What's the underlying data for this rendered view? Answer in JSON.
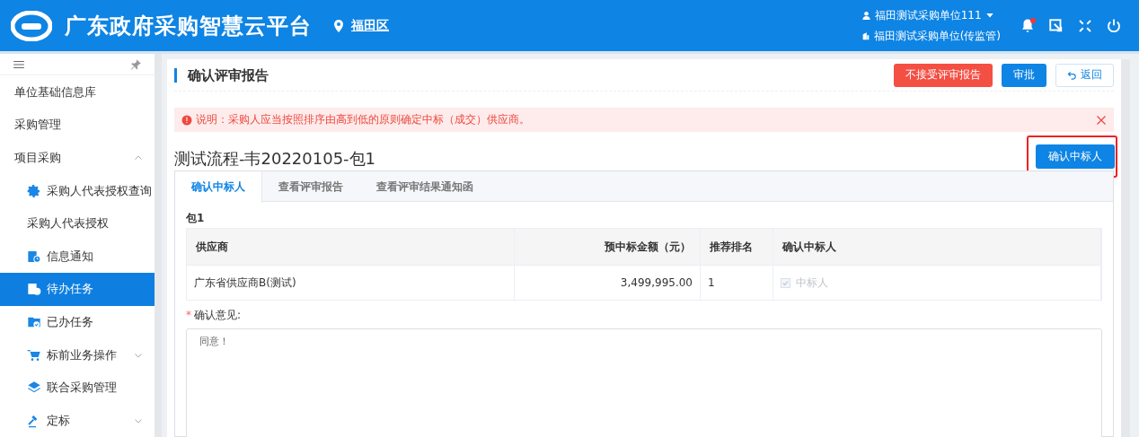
{
  "header": {
    "title": "广东政府采购智慧云平台",
    "region": "福田区",
    "user": "福田测试采购单位111",
    "org": "福田测试采购单位(传监管)",
    "has_notification": true
  },
  "sidebar": {
    "items": [
      {
        "label": "单位基础信息库",
        "selected": false
      },
      {
        "label": "采购管理",
        "selected": false
      },
      {
        "label": "项目采购",
        "selected": false,
        "expanded": true,
        "children": [
          {
            "label": "采购人代表授权查询",
            "kind": "settings",
            "selected": false
          },
          {
            "label": "采购人代表授权",
            "kind": "plain",
            "selected": false
          },
          {
            "label": "信息通知",
            "kind": "notice",
            "selected": false
          },
          {
            "label": "待办任务",
            "kind": "notice",
            "selected": true
          },
          {
            "label": "已办任务",
            "kind": "done",
            "selected": false
          },
          {
            "label": "标前业务操作",
            "kind": "shopping",
            "selected": false,
            "expanded": false
          },
          {
            "label": "联合采购管理",
            "kind": "joint",
            "selected": false
          },
          {
            "label": "定标",
            "kind": "award",
            "selected": false,
            "expanded": false
          }
        ]
      }
    ]
  },
  "page": {
    "title": "确认评审报告",
    "buttons": [
      {
        "label": "不接受评审报告",
        "kind": "danger"
      },
      {
        "label": "审批",
        "kind": "primary"
      },
      {
        "label": "返回",
        "kind": "back"
      }
    ],
    "alert": "说明：采购人应当按照排序由高到低的原则确定中标（成交）供应商。",
    "project": "测试流程-韦20220105-包1",
    "confirm_button": "确认中标人",
    "tabs": [
      {
        "label": "确认中标人",
        "selected": true
      },
      {
        "label": "查看评审报告",
        "selected": false
      },
      {
        "label": "查看评审结果通知函",
        "selected": false
      }
    ],
    "package": "包1",
    "table": {
      "columns": [
        "供应商",
        "预中标金额（元）",
        "推荐排名",
        "确认中标人"
      ],
      "rows": [
        {
          "supplier": "广东省供应商B(测试)",
          "amount": "3,499,995.00",
          "rank": "1",
          "winner": {
            "label": "中标人",
            "checked": true,
            "disabled": true
          }
        }
      ]
    },
    "opinion": {
      "required_mark": "*",
      "label": "确认意见:",
      "value": "同意！"
    }
  }
}
